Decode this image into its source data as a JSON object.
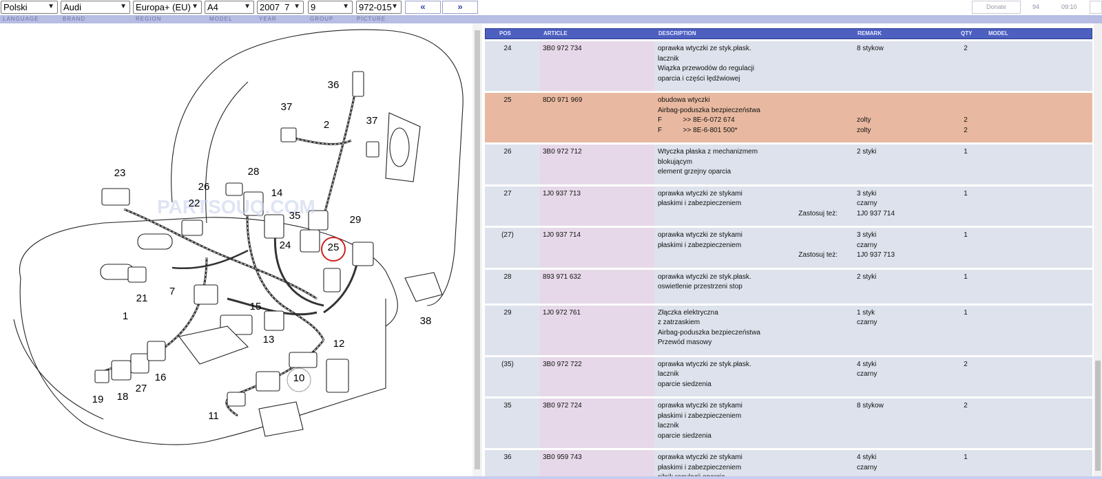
{
  "toolbar": {
    "language": "Polski",
    "brand": "Audi",
    "region": "Europa+ (EU)",
    "model": "A4",
    "year": "2007  7",
    "group": "9",
    "picture": "972-015",
    "prev_label": "«",
    "next_label": "»",
    "donate_label": "Donate",
    "count": "94",
    "time": "09:10"
  },
  "labels": {
    "language": "LANGUAGE",
    "brand": "BRAND",
    "region": "REGION",
    "model": "MODEL",
    "year": "YEAR",
    "group": "GROUP",
    "picture": "PICTURE"
  },
  "table": {
    "headers": {
      "pos": "POS",
      "article": "ARTICLE",
      "description": "DESCRIPTION",
      "remark": "REMARK",
      "qty": "QTY",
      "model": "MODEL"
    },
    "highlight_color": "#e8b9a0",
    "rows": [
      {
        "pos": "24",
        "article": "3B0 972 734",
        "lines": [
          {
            "desc": "oprawka wtyczki ze styk.płask.",
            "remark": "8 stykow",
            "qty": "2"
          },
          {
            "desc": "lacznik"
          },
          {
            "desc": "Wiązka przewodów do regulacji"
          },
          {
            "desc": "oparcia i części lędźwiowej"
          }
        ]
      },
      {
        "pos": "25",
        "article": "8D0 971 969",
        "highlight": true,
        "lines": [
          {
            "desc": "obudowa wtyczki"
          },
          {
            "desc": "Airbag-poduszka bezpieczeństwa"
          },
          {
            "desc": "F           >> 8E-6-072 674",
            "remark": "zolty",
            "qty": "2"
          },
          {
            "desc": "F           >> 8E-6-801 500*",
            "remark": "zolty",
            "qty": "2"
          }
        ]
      },
      {
        "pos": "26",
        "article": "3B0 972 712",
        "lines": [
          {
            "desc": "Wtyczka płaska z mechanizmem",
            "remark": "2 styki",
            "qty": "1"
          },
          {
            "desc": "blokującym"
          },
          {
            "desc": "element grzejny oparcia"
          }
        ]
      },
      {
        "pos": "27",
        "article": "1J0 937 713",
        "lines": [
          {
            "desc": "oprawka wtyczki ze stykami",
            "remark": "3 styki",
            "qty": "1"
          },
          {
            "desc": "płaskimi i zabezpieczeniem",
            "remark": "czarny"
          },
          {
            "note": "Zastosuj też:",
            "remark": "1J0 937 714"
          }
        ]
      },
      {
        "pos": "(27)",
        "article": "1J0 937 714",
        "lines": [
          {
            "desc": "oprawka wtyczki ze stykami",
            "remark": "3 styki",
            "qty": "1"
          },
          {
            "desc": "płaskimi i zabezpieczeniem",
            "remark": "czarny"
          },
          {
            "note": "Zastosuj też:",
            "remark": "1J0 937 713"
          }
        ]
      },
      {
        "pos": "28",
        "article": "893 971 632",
        "lines": [
          {
            "desc": "oprawka wtyczki ze styk.płask.",
            "remark": "2 styki",
            "qty": "1"
          },
          {
            "desc": "oswietlenie przestrzeni stop"
          }
        ]
      },
      {
        "pos": "29",
        "article": "1J0 972 761",
        "lines": [
          {
            "desc": "Złączka elektryczna",
            "remark": "1 styk",
            "qty": "1"
          },
          {
            "desc": "z zatrzaskiem",
            "remark": "czarny"
          },
          {
            "desc": "Airbag-poduszka bezpieczeństwa"
          },
          {
            "desc": "Przewód masowy"
          }
        ]
      },
      {
        "pos": "(35)",
        "article": "3B0 972 722",
        "lines": [
          {
            "desc": "oprawka wtyczki ze styk.płask.",
            "remark": "4 styki",
            "qty": "2"
          },
          {
            "desc": "lacznik",
            "remark": "czarny"
          },
          {
            "desc": "oparcie siedzenia"
          }
        ]
      },
      {
        "pos": "35",
        "article": "3B0 972 724",
        "lines": [
          {
            "desc": "oprawka wtyczki ze stykami",
            "remark": "8 stykow",
            "qty": "2"
          },
          {
            "desc": "płaskimi i zabezpieczeniem"
          },
          {
            "desc": "lacznik"
          },
          {
            "desc": "oparcie siedzenia"
          }
        ]
      },
      {
        "pos": "36",
        "article": "3B0 959 743",
        "lines": [
          {
            "desc": "oprawka wtyczki ze stykami",
            "remark": "4 styki",
            "qty": "1"
          },
          {
            "desc": "płaskimi i zabezpieczeniem",
            "remark": "czarny"
          },
          {
            "desc": "silnik regulacji oparcia"
          }
        ]
      }
    ]
  },
  "diagram": {
    "callouts": [
      "36",
      "37",
      "2",
      "37",
      "23",
      "26",
      "28",
      "14",
      "22",
      "35",
      "29",
      "24",
      "25",
      "7",
      "21",
      "15",
      "38",
      "1",
      "13",
      "12",
      "19",
      "18",
      "27",
      "16",
      "10",
      "11"
    ],
    "selected_callout": "25",
    "watermark": "PARTSOUQ.COM"
  }
}
